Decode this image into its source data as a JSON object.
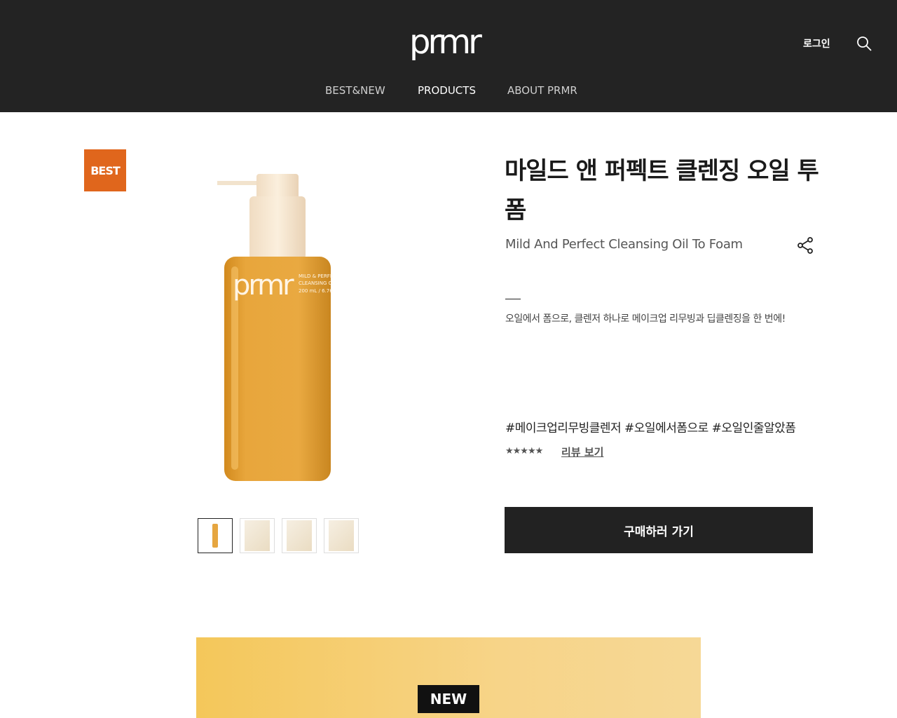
{
  "header": {
    "logo_text": "prmr",
    "login_label": "로그인",
    "nav": [
      "BEST&NEW",
      "PRODUCTS",
      "ABOUT PRMR"
    ],
    "active_nav": "PRODUCTS"
  },
  "product": {
    "badge": "BEST",
    "title": "마일드 앤 퍼펙트 클렌징 오일 투 폼",
    "subtitle": "Mild And Perfect Cleansing Oil To Foam",
    "description": "오일에서 폼으로, 클렌저 하나로 메이크업 리무빙과 딥클렌징을 한 번에!",
    "tags": "#메이크업리무빙클렌저 #오일에서폼으로 #오일인줄알았폼",
    "rating": 5,
    "stars_text": "★★★★★",
    "review_link": "리뷰 보기",
    "buy_label": "구매하러 가기",
    "thumbnail_count": 4,
    "bottle_label": "prmr",
    "bottle_small_lines": [
      "MILD & PERFE",
      "CLEANSING O",
      "200 mL / 6.76"
    ]
  },
  "banner": {
    "badge": "NEW"
  }
}
